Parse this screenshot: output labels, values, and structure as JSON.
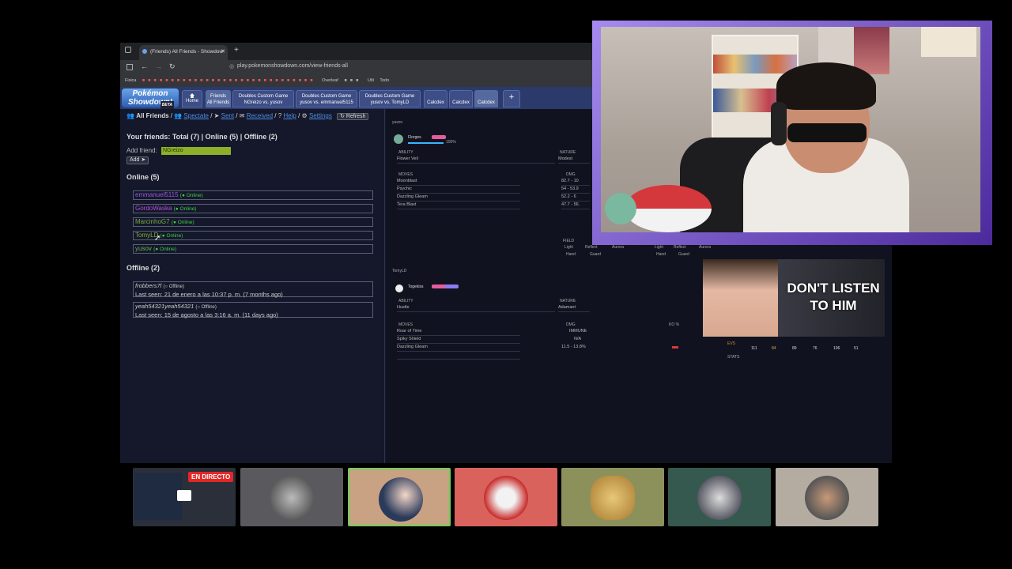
{
  "browser": {
    "tab_title": "(Friends) All Friends - Showdow",
    "url": "play.pokemonshowdown.com/view-friends-all",
    "bookmarks": [
      "Fisica",
      "Overleaf",
      "Util",
      "Todo"
    ],
    "ps_tabs": [
      {
        "top": "Friends",
        "bottom": "All Friends"
      },
      {
        "top": "Doubles Custom Game",
        "bottom": "NGreizo vs. yusov"
      },
      {
        "top": "Doubles Custom Game",
        "bottom": "yusov vs. emmanuel5115"
      },
      {
        "top": "Doubles Custom Game",
        "bottom": "yusov vs. TomyLD"
      },
      {
        "top": "",
        "bottom": "Calcdex"
      },
      {
        "top": "",
        "bottom": "Calcdex"
      },
      {
        "top": "",
        "bottom": "Calcdex"
      }
    ],
    "home_label": "Home",
    "logo_line1": "Pokémon",
    "logo_line2": "Showdown!",
    "logo_beta": "BETA",
    "plus_label": "+"
  },
  "friends": {
    "nav": {
      "all": "All Friends",
      "spectate": "Spectate",
      "sent": "Sent",
      "received": "Received",
      "help": "Help",
      "settings": "Settings",
      "refresh": "Refresh"
    },
    "summary": "Your friends: Total (7) | Online (5) | Offline (2)",
    "add_label": "Add friend:",
    "add_value": "NGreizo",
    "add_button": "Add",
    "online_header": "Online (5)",
    "online": [
      {
        "name": "emmanuel5115",
        "status": "(● Online)",
        "color": "#9a55e0"
      },
      {
        "name": "GordoWaska",
        "status": "(● Online)",
        "color": "#b34fdc"
      },
      {
        "name": "MarcinhoG7",
        "status": "(● Online)",
        "color": "#7aa84a"
      },
      {
        "name": "TomyLD",
        "status": "(● Online)",
        "color": "#7fae3a"
      },
      {
        "name": "yusov",
        "status": "(● Online)",
        "color": "#6ab44a"
      }
    ],
    "offline_header": "Offline (2)",
    "offline": [
      {
        "name": "frobbers7l",
        "status": "(○ Offline)",
        "seen": "Last seen: 21 de enero a las 10:37 p. m. (7 months ago)"
      },
      {
        "name": "yeah54321yeah54321",
        "status": "(○ Offline)",
        "seen": "Last seen: 15 de agosto a las 3:16 a. m. (11 days ago)"
      }
    ]
  },
  "calc": {
    "p1_player": "yusov",
    "p1_mon": "Florges",
    "p1_hp": "100%",
    "ability_label": "ABILITY",
    "nature_label": "NATURE",
    "p1_ability": "Flower Veil",
    "p1_nature": "Modest",
    "moves_label": "MOVES",
    "dmg_label": "DMG",
    "ko_label": "KO %",
    "p1_moves": [
      {
        "name": "Moonblast",
        "dmg": "82.7 - 10"
      },
      {
        "name": "Psychic",
        "dmg": "54 - 53.9"
      },
      {
        "name": "Dazzling Gleam",
        "dmg": "52.2 - 6"
      },
      {
        "name": "Tera Blast",
        "dmg": "47.7 - 56."
      }
    ],
    "field_label": "FIELD",
    "field_items": [
      "Light",
      "Reflect",
      "Aurora",
      "Light",
      "Reflect",
      "Aurora"
    ],
    "field_items2": [
      "Hand",
      "Guard",
      "Hand",
      "Guard"
    ],
    "p2_player": "TomyLD",
    "p2_mon": "Togekiss",
    "p2_ability": "Hustle",
    "p2_nature": "Adamant",
    "p2_moves": [
      {
        "name": "Roar of Time",
        "dmg": "IMMUNE"
      },
      {
        "name": "Spiky Shield",
        "dmg": "N/A"
      },
      {
        "name": "Dazzling Gleam",
        "dmg": "11.5 - 13.8%"
      }
    ],
    "stats_label": "STATS",
    "evs_label": "EVS",
    "stat_values": [
      "111",
      "84",
      "89",
      "76",
      "106",
      "51"
    ]
  },
  "overlay": {
    "clip_text": "DON'T LISTEN TO HIM",
    "live_badge": "EN DIRECTO"
  },
  "colors": {
    "accent": "#8a5cf0",
    "ps_header": "#2c3a6b",
    "link": "#4f8be6",
    "online": "#44c94a",
    "live": "#e02828"
  },
  "tiles": [
    {
      "name": "stream-preview",
      "bg": "#2b2f3a"
    },
    {
      "name": "avatar-dragon",
      "bg": "#5a5a5e"
    },
    {
      "name": "avatar-anime",
      "bg": "#c8a283"
    },
    {
      "name": "avatar-mascot",
      "bg": "#d9625c"
    },
    {
      "name": "avatar-cheetah",
      "bg": "#8c915c"
    },
    {
      "name": "avatar-dark-figure",
      "bg": "#35594f"
    },
    {
      "name": "avatar-sunglasses-man",
      "bg": "#b4aba1"
    }
  ]
}
